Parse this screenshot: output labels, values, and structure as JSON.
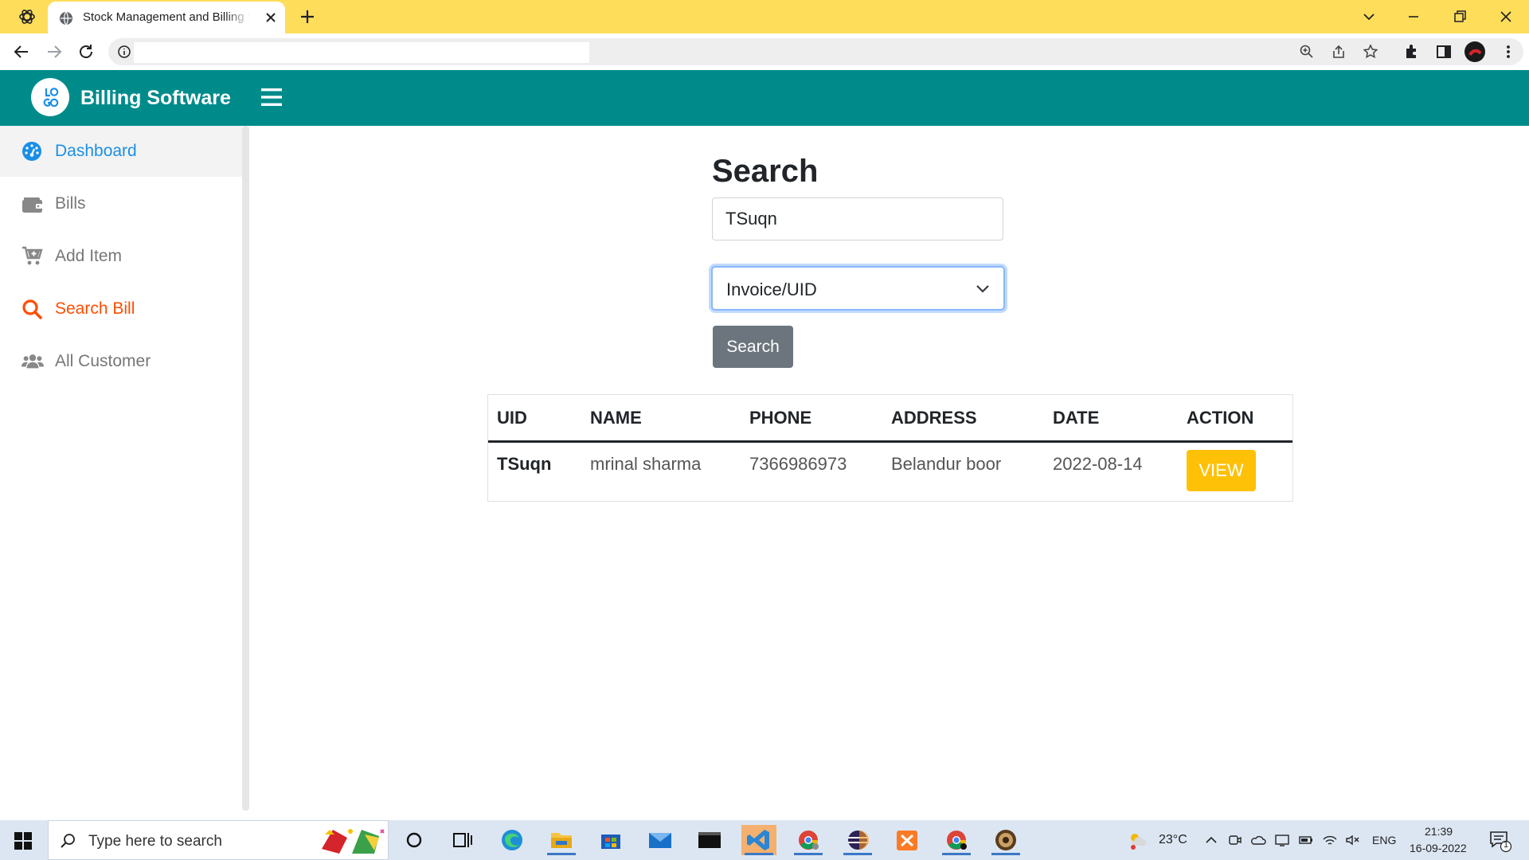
{
  "browser": {
    "tab_title": "Stock Management and Billing Software",
    "address": ""
  },
  "app": {
    "brand": "Billing Software",
    "logo_text": "LOGO"
  },
  "sidebar": {
    "items": [
      {
        "label": "Dashboard",
        "icon": "dashboard-icon"
      },
      {
        "label": "Bills",
        "icon": "wallet-icon"
      },
      {
        "label": "Add Item",
        "icon": "cart-plus-icon"
      },
      {
        "label": "Search Bill",
        "icon": "search-icon"
      },
      {
        "label": "All Customer",
        "icon": "users-icon"
      }
    ]
  },
  "search": {
    "heading": "Search",
    "query": "TSuqn",
    "select_value": "Invoice/UID",
    "button": "Search"
  },
  "table": {
    "headers": [
      "UID",
      "NAME",
      "PHONE",
      "ADDRESS",
      "DATE",
      "ACTION"
    ],
    "rows": [
      {
        "uid": "TSuqn",
        "name": "mrinal sharma",
        "phone": "7366986973",
        "address": "Belandur boor",
        "date": "2022-08-14",
        "action": "VIEW"
      }
    ]
  },
  "taskbar": {
    "search_placeholder": "Type here to search",
    "weather": "23°C",
    "lang": "ENG",
    "time": "21:39",
    "date": "16-09-2022",
    "notifications": "1"
  },
  "colors": {
    "appbar": "#008b8b",
    "tabstrip": "#fedd5b",
    "active_blue": "#1b8fe6",
    "active_orange": "#ff4d00",
    "view_button": "#ffc107",
    "search_button": "#6c757d"
  }
}
